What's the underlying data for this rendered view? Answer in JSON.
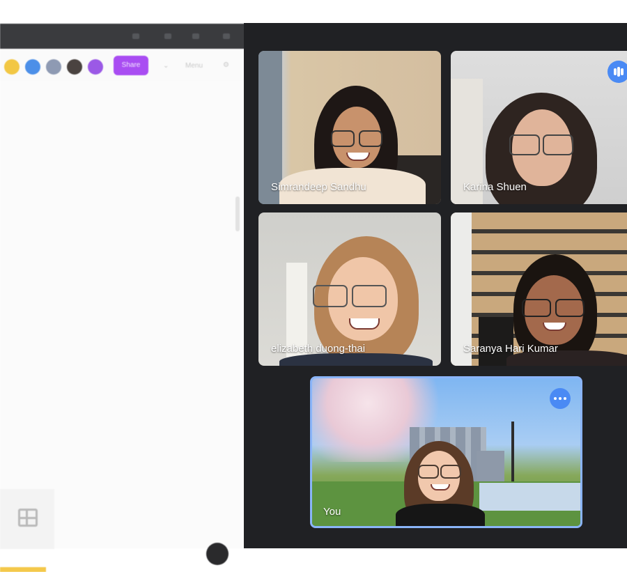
{
  "left_app": {
    "share_label": "Share",
    "toolbar_extra": "Menu"
  },
  "meet": {
    "participants": [
      {
        "name": "Simrandeep Sandhu"
      },
      {
        "name": "Karina Shuen"
      },
      {
        "name": "elizabeth duong-thai"
      },
      {
        "name": "Saranya Hari Kumar"
      }
    ],
    "self": {
      "name": "You"
    },
    "icons": {
      "audio": "audio-level-icon",
      "more": "more-options-icon"
    }
  }
}
